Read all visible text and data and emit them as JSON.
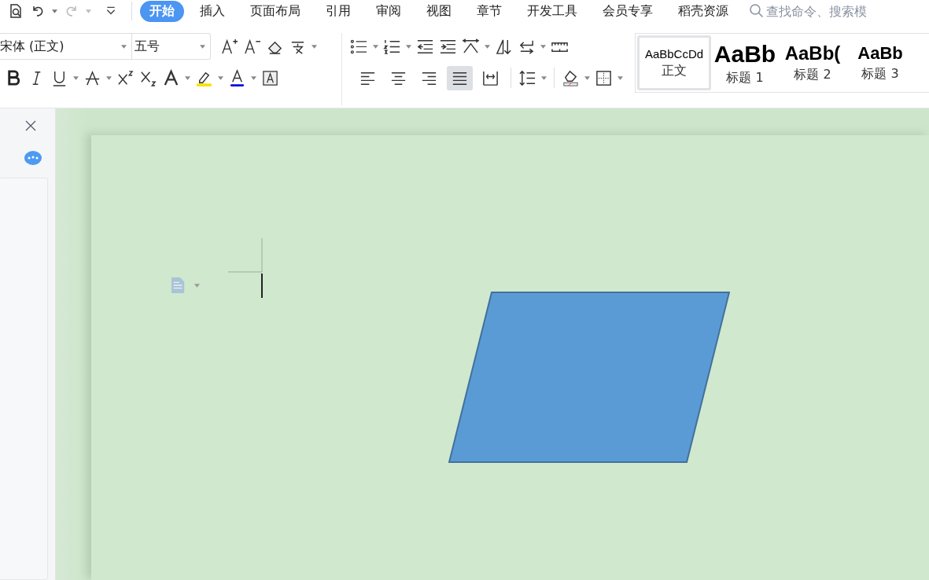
{
  "menu_tabs": [
    {
      "label": "开始",
      "selected": true
    },
    {
      "label": "插入",
      "selected": false
    },
    {
      "label": "页面布局",
      "selected": false
    },
    {
      "label": "引用",
      "selected": false
    },
    {
      "label": "审阅",
      "selected": false
    },
    {
      "label": "视图",
      "selected": false
    },
    {
      "label": "章节",
      "selected": false
    },
    {
      "label": "开发工具",
      "selected": false
    },
    {
      "label": "会员专享",
      "selected": false
    },
    {
      "label": "稻壳资源",
      "selected": false
    }
  ],
  "search": {
    "placeholder": "查找命令、搜索模"
  },
  "font": {
    "family": "宋体 (正文)",
    "size": "五号"
  },
  "alignment_buttons": [
    {
      "selected": false
    },
    {
      "selected": false
    },
    {
      "selected": false
    },
    {
      "selected": true
    },
    {
      "selected": false
    }
  ],
  "styles": [
    {
      "preview": "AaBbCcDd",
      "label": "正文",
      "kind": "body",
      "selected": true
    },
    {
      "preview": "AaBb",
      "label": "标题 1",
      "kind": "h1",
      "selected": false
    },
    {
      "preview": "AaBb(",
      "label": "标题 2",
      "kind": "h2",
      "selected": false
    },
    {
      "preview": "AaBb",
      "label": "标题 3",
      "kind": "h3",
      "selected": false
    }
  ]
}
